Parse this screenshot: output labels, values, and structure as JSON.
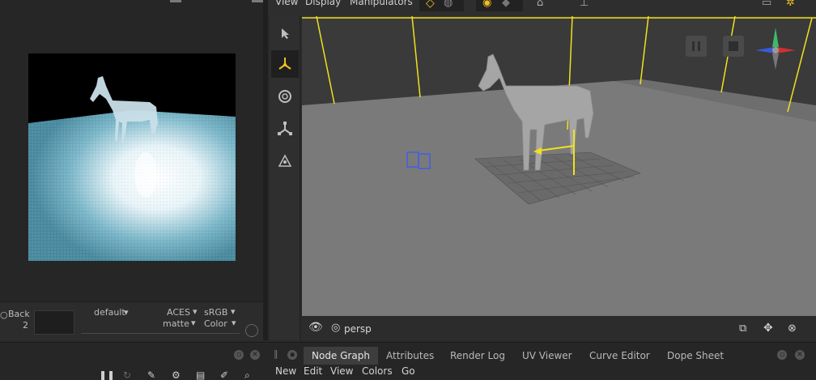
{
  "viewport_menu": [
    "View",
    "Display",
    "Manipulators"
  ],
  "left_controls": {
    "back_label": "Back",
    "back_value": "2",
    "default_label": "default",
    "aces_label": "ACES",
    "srgb_label": "sRGB",
    "matte_label": "matte",
    "color_label": "Color"
  },
  "viewport": {
    "camera_label": "persp"
  },
  "tabs": [
    {
      "label": "Node Graph",
      "active": true
    },
    {
      "label": "Attributes",
      "active": false
    },
    {
      "label": "Render Log",
      "active": false
    },
    {
      "label": "UV Viewer",
      "active": false
    },
    {
      "label": "Curve Editor",
      "active": false
    },
    {
      "label": "Dope Sheet",
      "active": false
    }
  ],
  "node_graph_menu": [
    "New",
    "Edit",
    "View",
    "Colors",
    "Go"
  ],
  "colors": {
    "accent_yellow": "#f0e020",
    "floor_teal": "#4a90a8",
    "panel_dark": "#262626"
  }
}
